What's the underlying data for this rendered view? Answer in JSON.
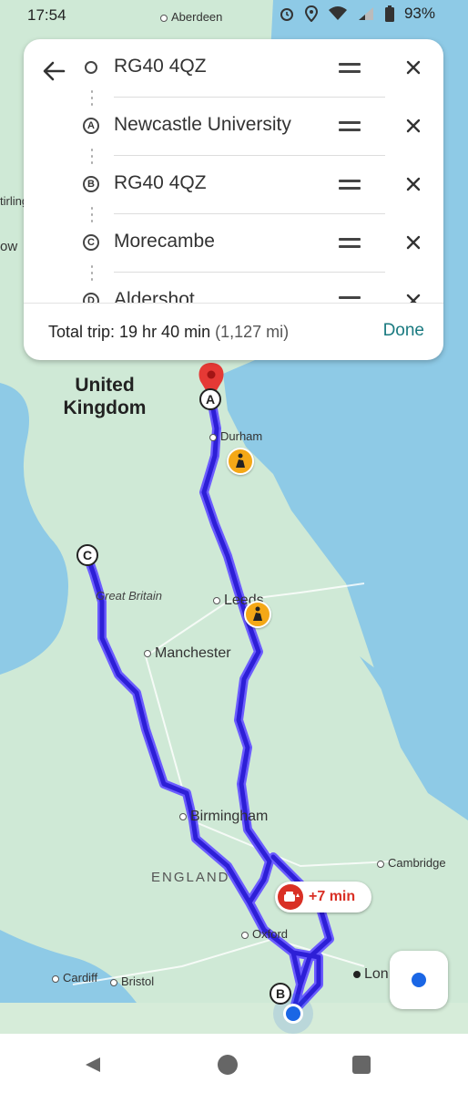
{
  "status_bar": {
    "time": "17:54",
    "battery": "93%",
    "icons": [
      "alarm-icon",
      "location-icon",
      "wifi-icon",
      "signal-icon",
      "battery-icon"
    ]
  },
  "directions": {
    "stops": [
      {
        "marker": "",
        "name": "RG40 4QZ"
      },
      {
        "marker": "A",
        "name": "Newcastle University"
      },
      {
        "marker": "B",
        "name": "RG40 4QZ"
      },
      {
        "marker": "C",
        "name": "Morecambe"
      },
      {
        "marker": "D",
        "name": "Aldershot"
      }
    ],
    "summary_label": "Total trip: 19 hr 40 min",
    "summary_distance": "(1,127 mi)",
    "done_label": "Done"
  },
  "map": {
    "country_label": "United Kingdom",
    "region_label": "ENGLAND",
    "island_label": "Great Britain",
    "cities": {
      "aberdeen": "Aberdeen",
      "durham": "Durham",
      "leeds": "Leeds",
      "manchester": "Manchester",
      "birmingham": "Birmingham",
      "cambridge": "Cambridge",
      "oxford": "Oxford",
      "cardiff": "Cardiff",
      "bristol": "Bristol",
      "london": "Lon",
      "stirling": "tirling",
      "glasgow": "ow"
    },
    "route_markers": {
      "a": "A",
      "b": "B",
      "c": "C"
    },
    "traffic_delay": "+7 min",
    "colors": {
      "land": "#cfe9d6",
      "sea": "#8ecae6",
      "route": "#2d1fd6",
      "destination_pin": "#e53935",
      "traffic": "#d93025",
      "done": "#1a7a80"
    }
  }
}
